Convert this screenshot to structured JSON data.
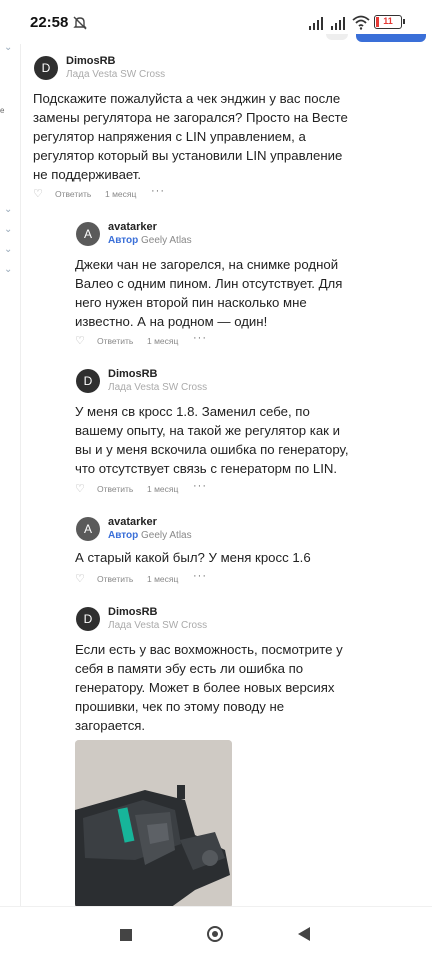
{
  "status_bar": {
    "time": "22:58",
    "battery": "11"
  },
  "sidebar": {
    "fragment": "e"
  },
  "comments": [
    {
      "user": "DimosRB",
      "avatar_letter": "D",
      "car": "Лада Vesta SW Cross",
      "author_badge": "",
      "text_lines": [
        "Подскажите пожалуйста а чек энджин у вас после",
        "замены регулятора не загорался? Просто на Весте",
        "регулятор напряжения с LIN управлением, а",
        "регулятор который вы установили LIN управление",
        "не поддерживает."
      ],
      "reply": "Ответить",
      "time": "1 месяц",
      "more": "···"
    },
    {
      "user": "avatarker",
      "avatar_letter": "A",
      "car": "Geely Atlas",
      "author_badge": "Автор",
      "text_lines": [
        "Джеки чан не загорелся, на снимке родной",
        "Валео с одним пином. Лин отсутствует. Для",
        "него нужен второй пин насколько мне",
        "известно. А на родном — один!"
      ],
      "reply": "Ответить",
      "time": "1 месяц",
      "more": "···"
    },
    {
      "user": "DimosRB",
      "avatar_letter": "D",
      "car": "Лада Vesta SW Cross",
      "author_badge": "",
      "text_lines": [
        "У меня св кросс 1.8. Заменил себе, по",
        "вашему опыту, на такой же регулятор как и",
        "вы и у меня вскочила ошибка по генератору,",
        "что отсутствует связь с генераторм по LIN."
      ],
      "reply": "Ответить",
      "time": "1 месяц",
      "more": "···"
    },
    {
      "user": "avatarker",
      "avatar_letter": "A",
      "car": "Geely Atlas",
      "author_badge": "Автор",
      "text_lines": [
        "А старый какой был? У меня кросс 1.6"
      ],
      "reply": "Ответить",
      "time": "1 месяц",
      "more": "···"
    },
    {
      "user": "DimosRB",
      "avatar_letter": "D",
      "car": "Лада Vesta SW Cross",
      "author_badge": "",
      "text_lines": [
        "Если есть у вас вохможность, посмотрите у",
        "себя в памяти эбу есть ли ошибка по",
        "генератору. Может в более новых версиях",
        "прошивки, чек по этому поводу не",
        "загорается."
      ],
      "reply": "",
      "time": "",
      "more": ""
    }
  ]
}
